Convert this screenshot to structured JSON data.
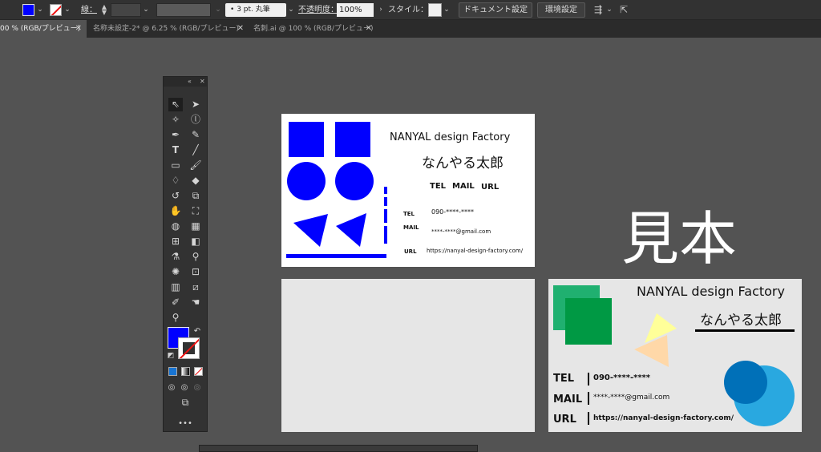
{
  "control_bar": {
    "stroke_label": "線：",
    "brush_value": "3 pt. 丸筆",
    "opacity_label": "不透明度：",
    "opacity_value": "100%",
    "style_label": "スタイル：",
    "doc_setup_button": "ドキュメント設定",
    "prefs_button": "環境設定"
  },
  "tabs": [
    {
      "label": "00 % (RGB/プレビュー)",
      "active": true
    },
    {
      "label": "名称未設定-2* @ 6.25 % (RGB/プレビュー)",
      "active": false
    },
    {
      "label": "名刺.ai @ 100 % (RGB/プレビュー)",
      "active": false
    }
  ],
  "tools_panel": {
    "more_label": "•••",
    "tools": [
      "selection-tool",
      "direct-selection-tool",
      "magic-wand-tool",
      "lasso-tool",
      "pen-tool",
      "curvature-tool",
      "type-tool",
      "line-tool",
      "rectangle-tool",
      "paintbrush-tool",
      "shaper-tool",
      "eraser-tool",
      "rotate-tool",
      "scale-tool",
      "warp-tool",
      "free-transform-tool",
      "shape-builder-tool",
      "perspective-grid-tool",
      "mesh-tool",
      "gradient-tool",
      "eyedropper-tool",
      "blend-tool",
      "symbol-sprayer-tool",
      "artboard-tool",
      "column-graph-tool",
      "slice-tool",
      "hand-tool",
      "zoom-tool"
    ]
  },
  "colors": {
    "fill": "#0000ff",
    "stroke": "none"
  },
  "card1": {
    "company": "NANYAL design Factory",
    "name": "なんやる太郎",
    "header_tel": "TEL",
    "header_mail": "MAIL",
    "header_url": "URL",
    "tel_label": "TEL",
    "tel_value": "090-****-****",
    "mail_label": "MAIL",
    "mail_value": "****-****@gmail.com",
    "url_label": "URL",
    "url_value": "https://nanyal-design-factory.com/"
  },
  "sample_title": "見本",
  "card_sample": {
    "company": "NANYAL design Factory",
    "name": "なんやる太郎",
    "tel_label": "TEL",
    "tel_value": "090-****-****",
    "mail_label": "MAIL",
    "mail_value": "****-****@gmail.com",
    "url_label": "URL",
    "url_value": "https://nanyal-design-factory.com/"
  }
}
